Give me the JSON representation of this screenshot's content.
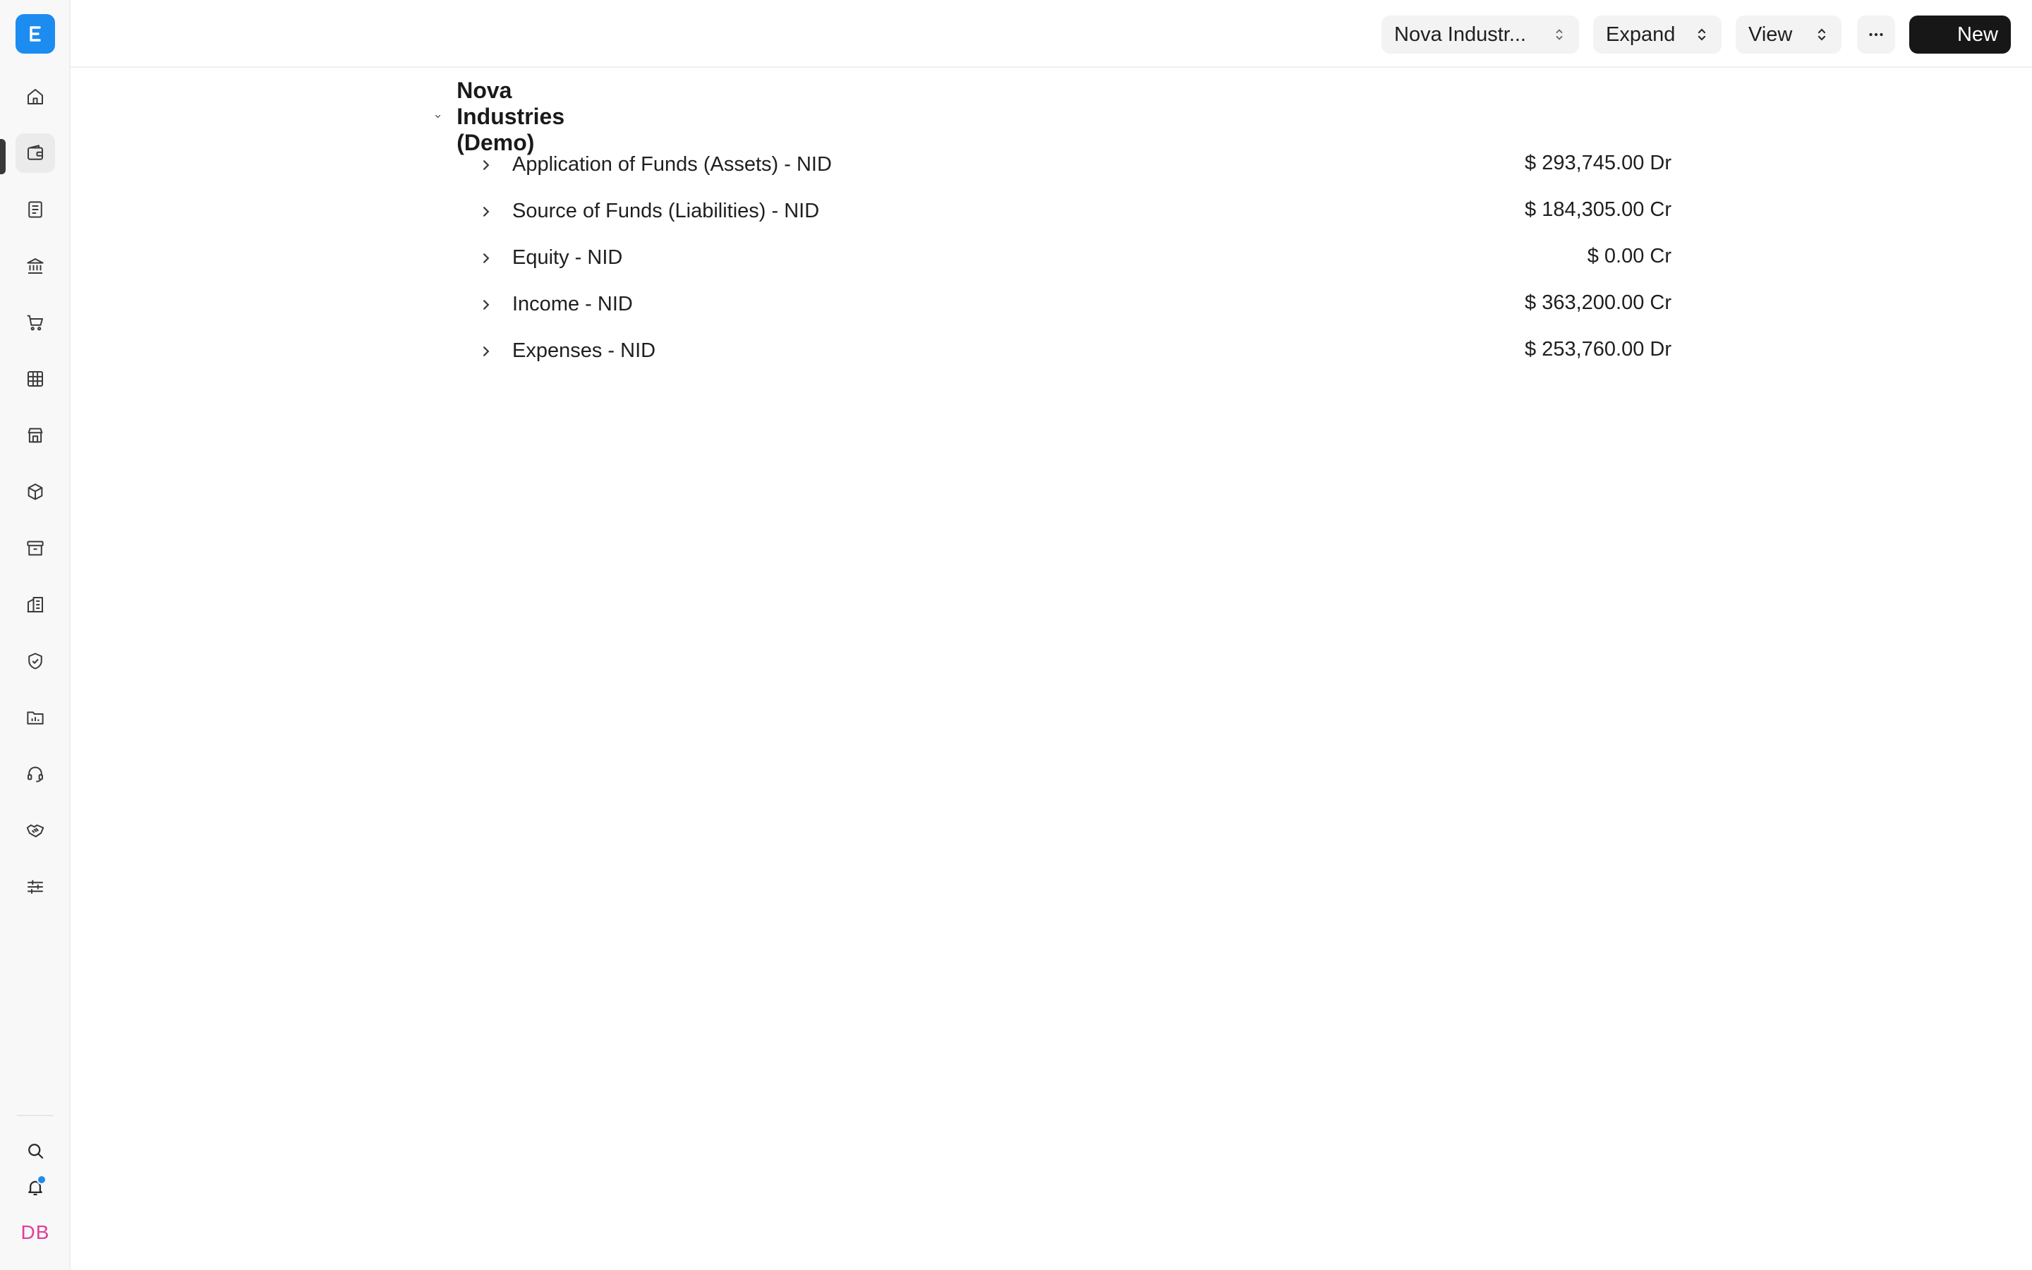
{
  "sidebar": {
    "logo_icon": "erpnext-logo-icon",
    "brand_color": "#1c8cf0",
    "nav_items": [
      {
        "icon": "home-icon",
        "active": false
      },
      {
        "icon": "wallet-icon",
        "active": true
      },
      {
        "icon": "document-icon",
        "active": false
      },
      {
        "icon": "bank-icon",
        "active": false
      },
      {
        "icon": "cart-icon",
        "active": false
      },
      {
        "icon": "table-icon",
        "active": false
      },
      {
        "icon": "store-icon",
        "active": false
      },
      {
        "icon": "package-icon",
        "active": false
      },
      {
        "icon": "archive-icon",
        "active": false
      },
      {
        "icon": "building-icon",
        "active": false
      },
      {
        "icon": "shield-check-icon",
        "active": false
      },
      {
        "icon": "folder-chart-icon",
        "active": false
      },
      {
        "icon": "headset-icon",
        "active": false
      },
      {
        "icon": "handshake-icon",
        "active": false
      },
      {
        "icon": "sliders-icon",
        "active": false
      }
    ],
    "bottom": {
      "search_icon": "search-icon",
      "notification_icon": "bell-icon",
      "avatar_initials": "DB",
      "avatar_color": "#e23d9a"
    }
  },
  "toolbar": {
    "company_select": "Nova Industr...",
    "expand_label": "Expand",
    "view_label": "View",
    "more_icon": "ellipsis-icon",
    "new_label": "New"
  },
  "tree": {
    "root": {
      "label": "Nova Industries (Demo)",
      "expanded": true
    },
    "accounts": [
      {
        "name": "Application of Funds (Assets) - NID",
        "balance": "$ 293,745.00 Dr"
      },
      {
        "name": "Source of Funds (Liabilities) - NID",
        "balance": "$ 184,305.00 Cr"
      },
      {
        "name": "Equity - NID",
        "balance": "$ 0.00 Cr"
      },
      {
        "name": "Income - NID",
        "balance": "$ 363,200.00 Cr"
      },
      {
        "name": "Expenses - NID",
        "balance": "$ 253,760.00 Dr"
      }
    ]
  }
}
